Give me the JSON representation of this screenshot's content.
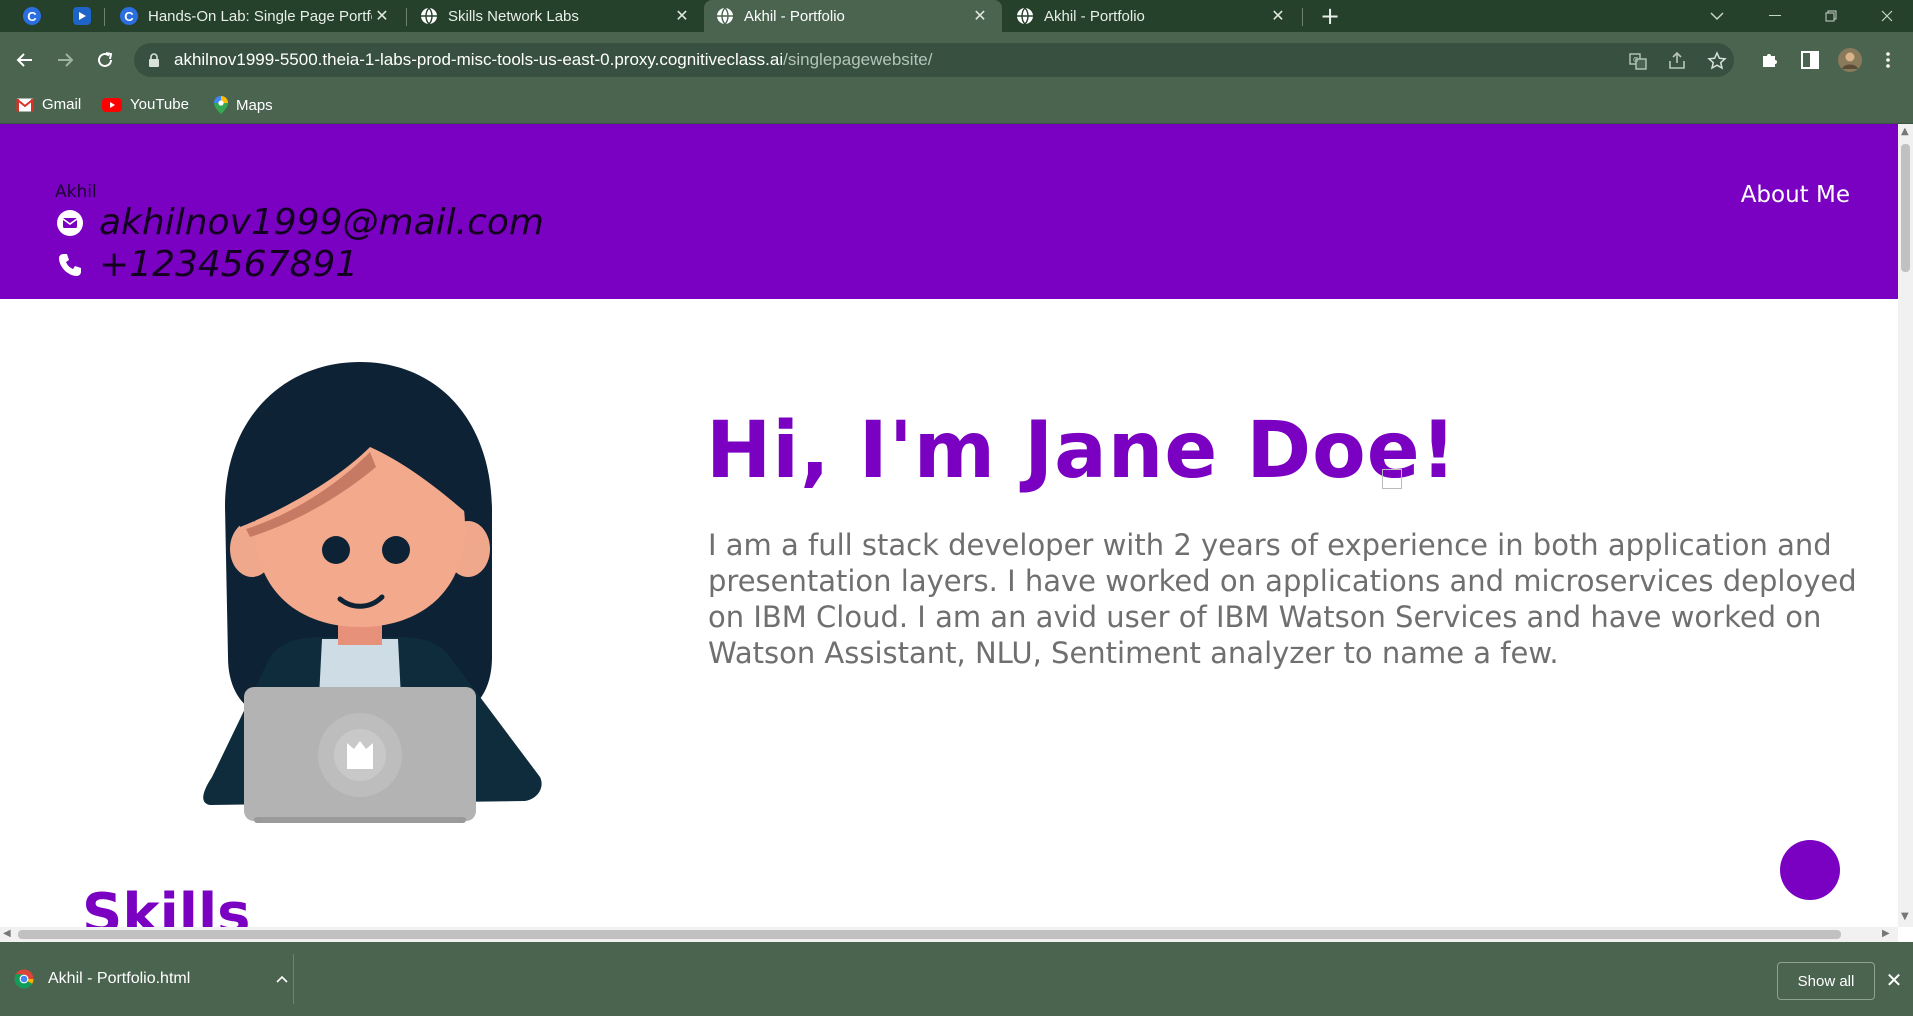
{
  "browser": {
    "tabs": [
      {
        "title": "Hands-On Lab: Single Page Portfo",
        "favicon": "cognitiveclass-icon",
        "active": false
      },
      {
        "title": "Skills Network Labs",
        "favicon": "globe-icon",
        "active": false
      },
      {
        "title": "Akhil - Portfolio",
        "favicon": "globe-icon",
        "active": true
      },
      {
        "title": "Akhil - Portfolio",
        "favicon": "globe-icon",
        "active": false
      }
    ],
    "address_bar": {
      "host": "akhilnov1999-5500.theia-1-labs-prod-misc-tools-us-east-0.proxy.cognitiveclass.ai",
      "path": "/singlepagewebsite/"
    },
    "bookmarks": [
      {
        "label": "Gmail",
        "icon": "gmail-icon"
      },
      {
        "label": "YouTube",
        "icon": "youtube-icon"
      },
      {
        "label": "Maps",
        "icon": "maps-icon"
      }
    ],
    "download_bar": {
      "file_name": "Akhil - Portfolio.html",
      "show_all_label": "Show all"
    }
  },
  "page": {
    "header": {
      "brand": "Akhil",
      "email": "akhilnov1999@mail.com",
      "phone": "+1234567891",
      "nav_about": "About Me",
      "background_color": "#7a00c2"
    },
    "hero": {
      "heading": "Hi, I'm Jane Doe!",
      "description": "I am a full stack developer with 2 years of experience in both application and presentation layers. I have worked on applications and microservices deployed on IBM Cloud. I am an avid user of IBM Watson Services and have worked on Watson Assistant, NLU, Sentiment analyzer to name a few."
    },
    "skills_heading": "Skills",
    "accent_color": "#7a00c2"
  }
}
